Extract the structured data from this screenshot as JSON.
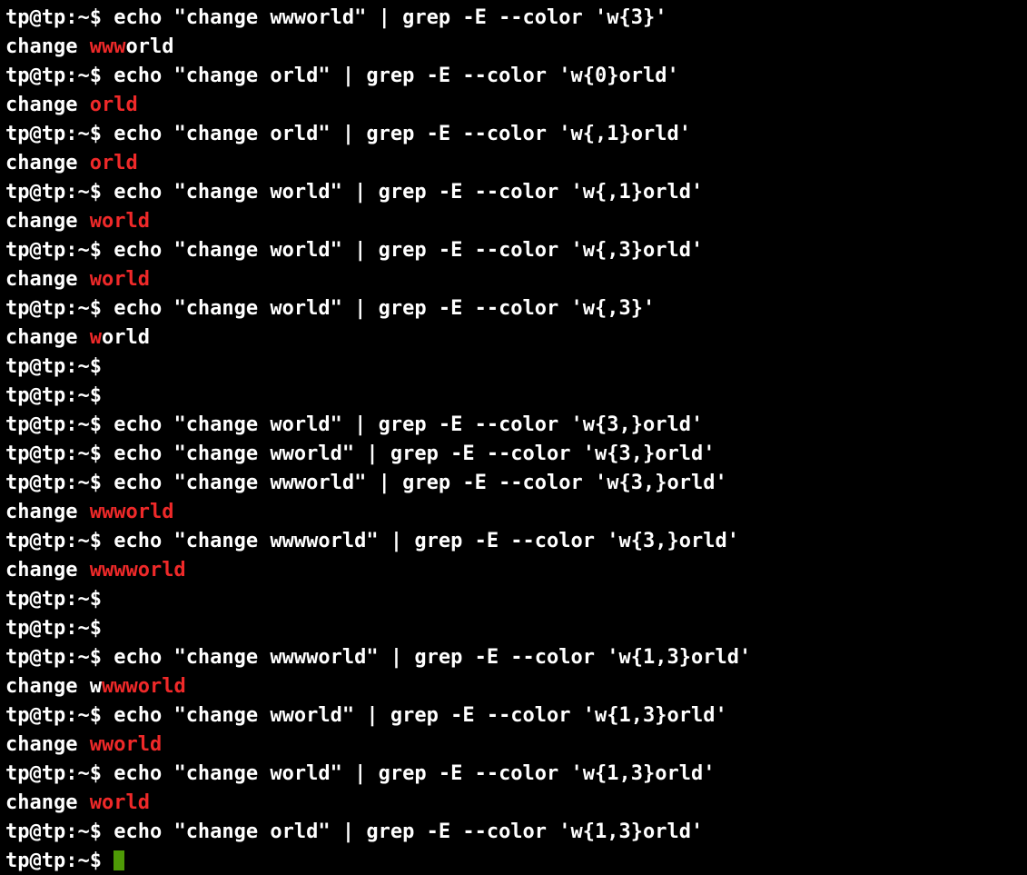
{
  "prompt": "tp@tp:~$ ",
  "lines": [
    {
      "type": "cmd",
      "text": "echo \"change wwworld\" | grep -E --color 'w{3}'"
    },
    {
      "type": "out",
      "segments": [
        {
          "t": "change "
        },
        {
          "t": "www",
          "hl": true
        },
        {
          "t": "orld"
        }
      ]
    },
    {
      "type": "cmd",
      "text": "echo \"change orld\" | grep -E --color 'w{0}orld'"
    },
    {
      "type": "out",
      "segments": [
        {
          "t": "change "
        },
        {
          "t": "orld",
          "hl": true
        }
      ]
    },
    {
      "type": "cmd",
      "text": "echo \"change orld\" | grep -E --color 'w{,1}orld'"
    },
    {
      "type": "out",
      "segments": [
        {
          "t": "change "
        },
        {
          "t": "orld",
          "hl": true
        }
      ]
    },
    {
      "type": "cmd",
      "text": "echo \"change world\" | grep -E --color 'w{,1}orld'"
    },
    {
      "type": "out",
      "segments": [
        {
          "t": "change "
        },
        {
          "t": "world",
          "hl": true
        }
      ]
    },
    {
      "type": "cmd",
      "text": "echo \"change world\" | grep -E --color 'w{,3}orld'"
    },
    {
      "type": "out",
      "segments": [
        {
          "t": "change "
        },
        {
          "t": "world",
          "hl": true
        }
      ]
    },
    {
      "type": "cmd",
      "text": "echo \"change world\" | grep -E --color 'w{,3}'"
    },
    {
      "type": "out",
      "segments": [
        {
          "t": "change "
        },
        {
          "t": "w",
          "hl": true
        },
        {
          "t": "orld"
        }
      ]
    },
    {
      "type": "prompt"
    },
    {
      "type": "prompt"
    },
    {
      "type": "cmd",
      "text": "echo \"change world\" | grep -E --color 'w{3,}orld'"
    },
    {
      "type": "cmd",
      "text": "echo \"change wworld\" | grep -E --color 'w{3,}orld'"
    },
    {
      "type": "cmd",
      "text": "echo \"change wwworld\" | grep -E --color 'w{3,}orld'"
    },
    {
      "type": "out",
      "segments": [
        {
          "t": "change "
        },
        {
          "t": "wwworld",
          "hl": true
        }
      ]
    },
    {
      "type": "cmd",
      "text": "echo \"change wwwworld\" | grep -E --color 'w{3,}orld'"
    },
    {
      "type": "out",
      "segments": [
        {
          "t": "change "
        },
        {
          "t": "wwwworld",
          "hl": true
        }
      ]
    },
    {
      "type": "prompt"
    },
    {
      "type": "prompt"
    },
    {
      "type": "cmd",
      "text": "echo \"change wwwworld\" | grep -E --color 'w{1,3}orld'"
    },
    {
      "type": "out",
      "segments": [
        {
          "t": "change w"
        },
        {
          "t": "wwworld",
          "hl": true
        }
      ]
    },
    {
      "type": "cmd",
      "text": "echo \"change wworld\" | grep -E --color 'w{1,3}orld'"
    },
    {
      "type": "out",
      "segments": [
        {
          "t": "change "
        },
        {
          "t": "wworld",
          "hl": true
        }
      ]
    },
    {
      "type": "cmd",
      "text": "echo \"change world\" | grep -E --color 'w{1,3}orld'"
    },
    {
      "type": "out",
      "segments": [
        {
          "t": "change "
        },
        {
          "t": "world",
          "hl": true
        }
      ]
    },
    {
      "type": "cmd",
      "text": "echo \"change orld\" | grep -E --color 'w{1,3}orld'"
    },
    {
      "type": "prompt",
      "cursor": true
    }
  ]
}
